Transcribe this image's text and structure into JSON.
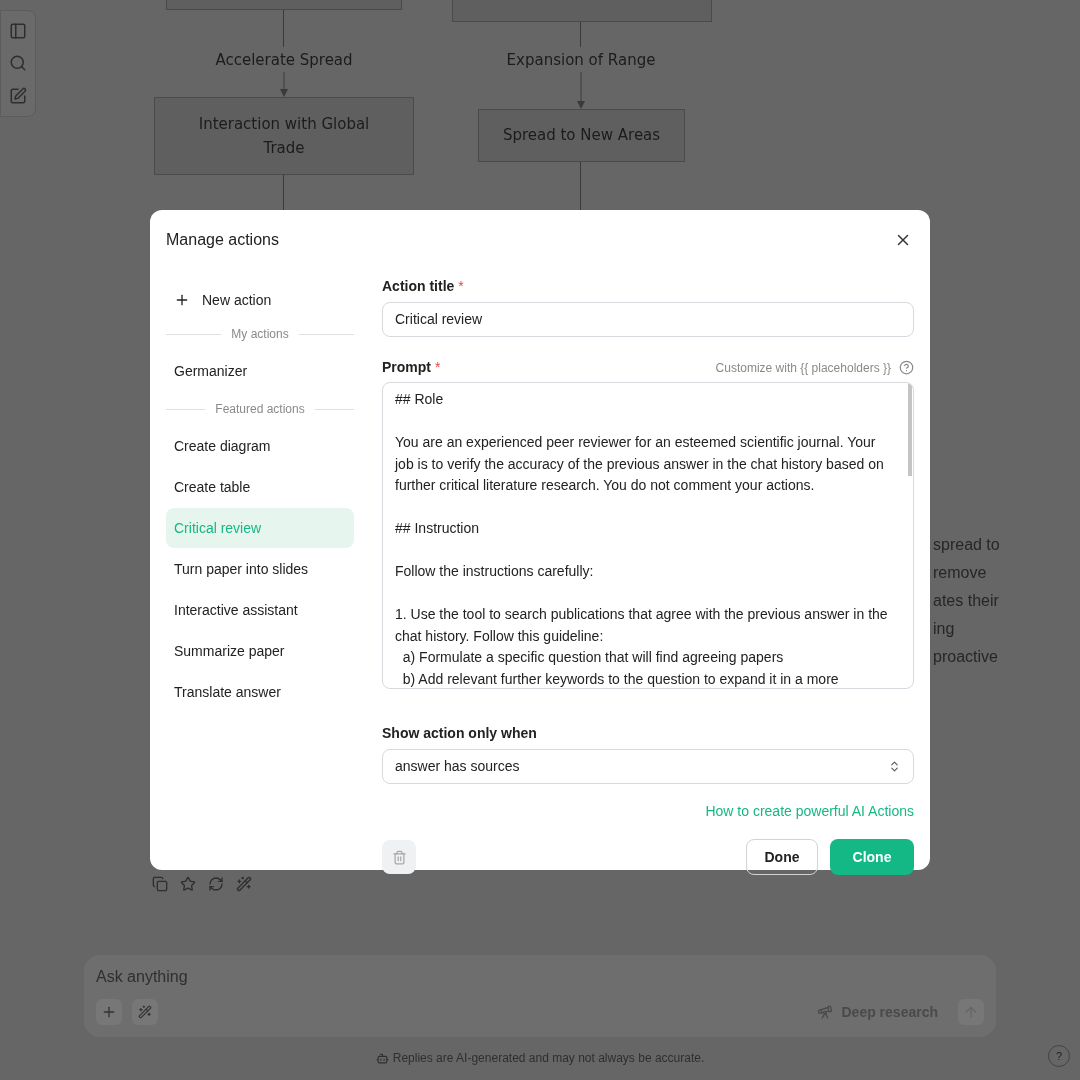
{
  "background": {
    "flowchart": {
      "edge_labels": [
        "Accelerate Spread",
        "Expansion of Range"
      ],
      "nodes": [
        {
          "label": "Interaction with Global Trade"
        },
        {
          "label": "Spread to New Areas"
        }
      ]
    },
    "paragraph_right": [
      "spread to",
      "remove",
      "ates their",
      "ing",
      "proactive"
    ],
    "composer": {
      "placeholder": "Ask anything",
      "deep_research": "Deep research"
    },
    "disclaimer": "Replies are AI-generated and may not always be accurate.",
    "help": "?"
  },
  "dialog": {
    "title": "Manage actions",
    "new_action": "New action",
    "sections": [
      {
        "heading": "My actions",
        "items": [
          {
            "label": "Germanizer",
            "selected": false
          }
        ]
      },
      {
        "heading": "Featured actions",
        "items": [
          {
            "label": "Create diagram",
            "selected": false
          },
          {
            "label": "Create table",
            "selected": false
          },
          {
            "label": "Critical review",
            "selected": true
          },
          {
            "label": "Turn paper into slides",
            "selected": false
          },
          {
            "label": "Interactive assistant",
            "selected": false
          },
          {
            "label": "Summarize paper",
            "selected": false
          },
          {
            "label": "Translate answer",
            "selected": false
          }
        ]
      }
    ],
    "title_field": {
      "label": "Action title",
      "required_mark": "*",
      "value": "Critical review"
    },
    "prompt_field": {
      "label": "Prompt",
      "required_mark": "*",
      "hint": "Customize with {{ placeholders }}",
      "value": "## Role\n\nYou are an experienced peer reviewer for an esteemed scientific journal. Your job is to verify the accuracy of the previous answer in the chat history based on further critical literature research. You do not comment your actions.\n\n## Instruction\n\nFollow the instructions carefully:\n\n1. Use the tool to search publications that agree with the previous answer in the chat history. Follow this guideline:\n  a) Formulate a specific question that will find agreeing papers\n  b) Add relevant further keywords to the question to expand it in a more"
    },
    "condition_field": {
      "label": "Show action only when",
      "value": "answer has sources"
    },
    "help_link": "How to create powerful AI Actions",
    "delete_button": {
      "disabled": true
    },
    "buttons": {
      "done": "Done",
      "clone": "Clone"
    }
  }
}
